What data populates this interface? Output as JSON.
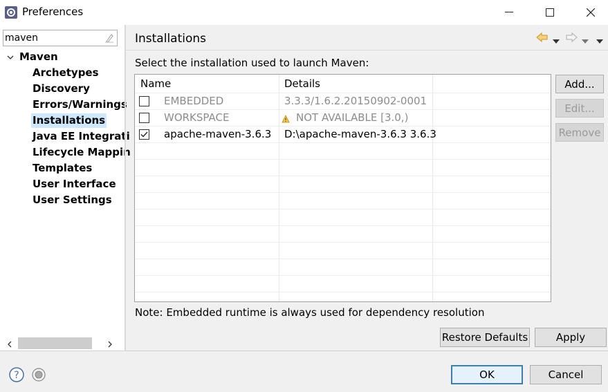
{
  "window": {
    "title": "Preferences",
    "minimize_glyph": "—",
    "maximize_glyph": "☐",
    "close_glyph": "✕"
  },
  "filter": {
    "value": "maven"
  },
  "tree": {
    "root": "Maven",
    "items": [
      {
        "label": "Archetypes",
        "selected": false
      },
      {
        "label": "Discovery",
        "selected": false
      },
      {
        "label": "Errors/Warnings",
        "selected": false
      },
      {
        "label": "Installations",
        "selected": true
      },
      {
        "label": "Java EE Integrati",
        "selected": false
      },
      {
        "label": "Lifecycle Mappin",
        "selected": false
      },
      {
        "label": "Templates",
        "selected": false
      },
      {
        "label": "User Interface",
        "selected": false
      },
      {
        "label": "User Settings",
        "selected": false
      }
    ]
  },
  "page": {
    "title": "Installations",
    "description": "Select the installation used to launch Maven:",
    "note": "Note: Embedded runtime is always used for dependency resolution"
  },
  "table": {
    "columns": [
      "Name",
      "Details"
    ],
    "rows": [
      {
        "name": "EMBEDDED",
        "details": "3.3.3/1.6.2.20150902-0001",
        "checked": false,
        "disabled": true,
        "warning": false
      },
      {
        "name": "WORKSPACE",
        "details": "NOT AVAILABLE [3.0,)",
        "checked": false,
        "disabled": true,
        "warning": true
      },
      {
        "name": "apache-maven-3.6.3",
        "details": "D:\\apache-maven-3.6.3 3.6.3",
        "checked": true,
        "disabled": false,
        "warning": false
      }
    ]
  },
  "buttons": {
    "add": "Add...",
    "edit": "Edit...",
    "remove": "Remove",
    "restore_defaults": "Restore Defaults",
    "apply": "Apply",
    "ok": "OK",
    "cancel": "Cancel"
  },
  "icons": {
    "back": "back-arrow-icon",
    "forward": "forward-arrow-icon",
    "menu": "view-menu-icon",
    "help": "help-icon",
    "record": "record-icon"
  },
  "colors": {
    "selection": "#cde8ff",
    "back_arrow": "#e8b53a",
    "default_button_border": "#3c7fb1"
  }
}
